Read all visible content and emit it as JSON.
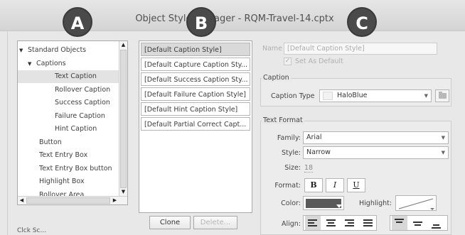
{
  "window": {
    "title": "Object Style Manager - RQM-Travel-14.cptx"
  },
  "callouts": [
    "A",
    "B",
    "C"
  ],
  "tree": {
    "items": [
      {
        "label": "Standard Objects",
        "level": 0,
        "expanded": true
      },
      {
        "label": "Captions",
        "level": 1,
        "expanded": true
      },
      {
        "label": "Text Caption",
        "level": 2,
        "selected": true
      },
      {
        "label": "Rollover Caption",
        "level": 2
      },
      {
        "label": "Success Caption",
        "level": 2
      },
      {
        "label": "Failure Caption",
        "level": 2
      },
      {
        "label": "Hint Caption",
        "level": 2
      },
      {
        "label": "Button",
        "level": 1
      },
      {
        "label": "Text Entry Box",
        "level": 1
      },
      {
        "label": "Text Entry Box button",
        "level": 1
      },
      {
        "label": "Highlight Box",
        "level": 1
      },
      {
        "label": "Rollover Area",
        "level": 1
      }
    ]
  },
  "status": {
    "partial_text": "Clck Sc..."
  },
  "styles": {
    "items": [
      "[Default Caption Style]",
      "[Default Capture Caption Sty...",
      "[Default Success Caption Sty...",
      "[Default Failure Caption Style]",
      "[Default Hint Caption Style]",
      "[Default Partial Correct Capt..."
    ],
    "selected_index": 0,
    "clone_label": "Clone",
    "delete_label": "Delete..."
  },
  "properties": {
    "name_label": "Name",
    "name_value": "[Default Caption Style]",
    "set_default_label": "Set As Default",
    "caption_group_label": "Caption",
    "caption_type_label": "Caption Type",
    "caption_type_value": "HaloBlue",
    "text_format_label": "Text Format",
    "family_label": "Family:",
    "family_value": "Arial",
    "style_label": "Style:",
    "style_value": "Narrow",
    "size_label": "Size:",
    "size_value": "18",
    "format_label": "Format:",
    "bold_label": "B",
    "italic_label": "I",
    "underline_label": "U",
    "color_label": "Color:",
    "color_value": "#5a5a5a",
    "highlight_label": "Highlight:",
    "align_label": "Align:"
  }
}
